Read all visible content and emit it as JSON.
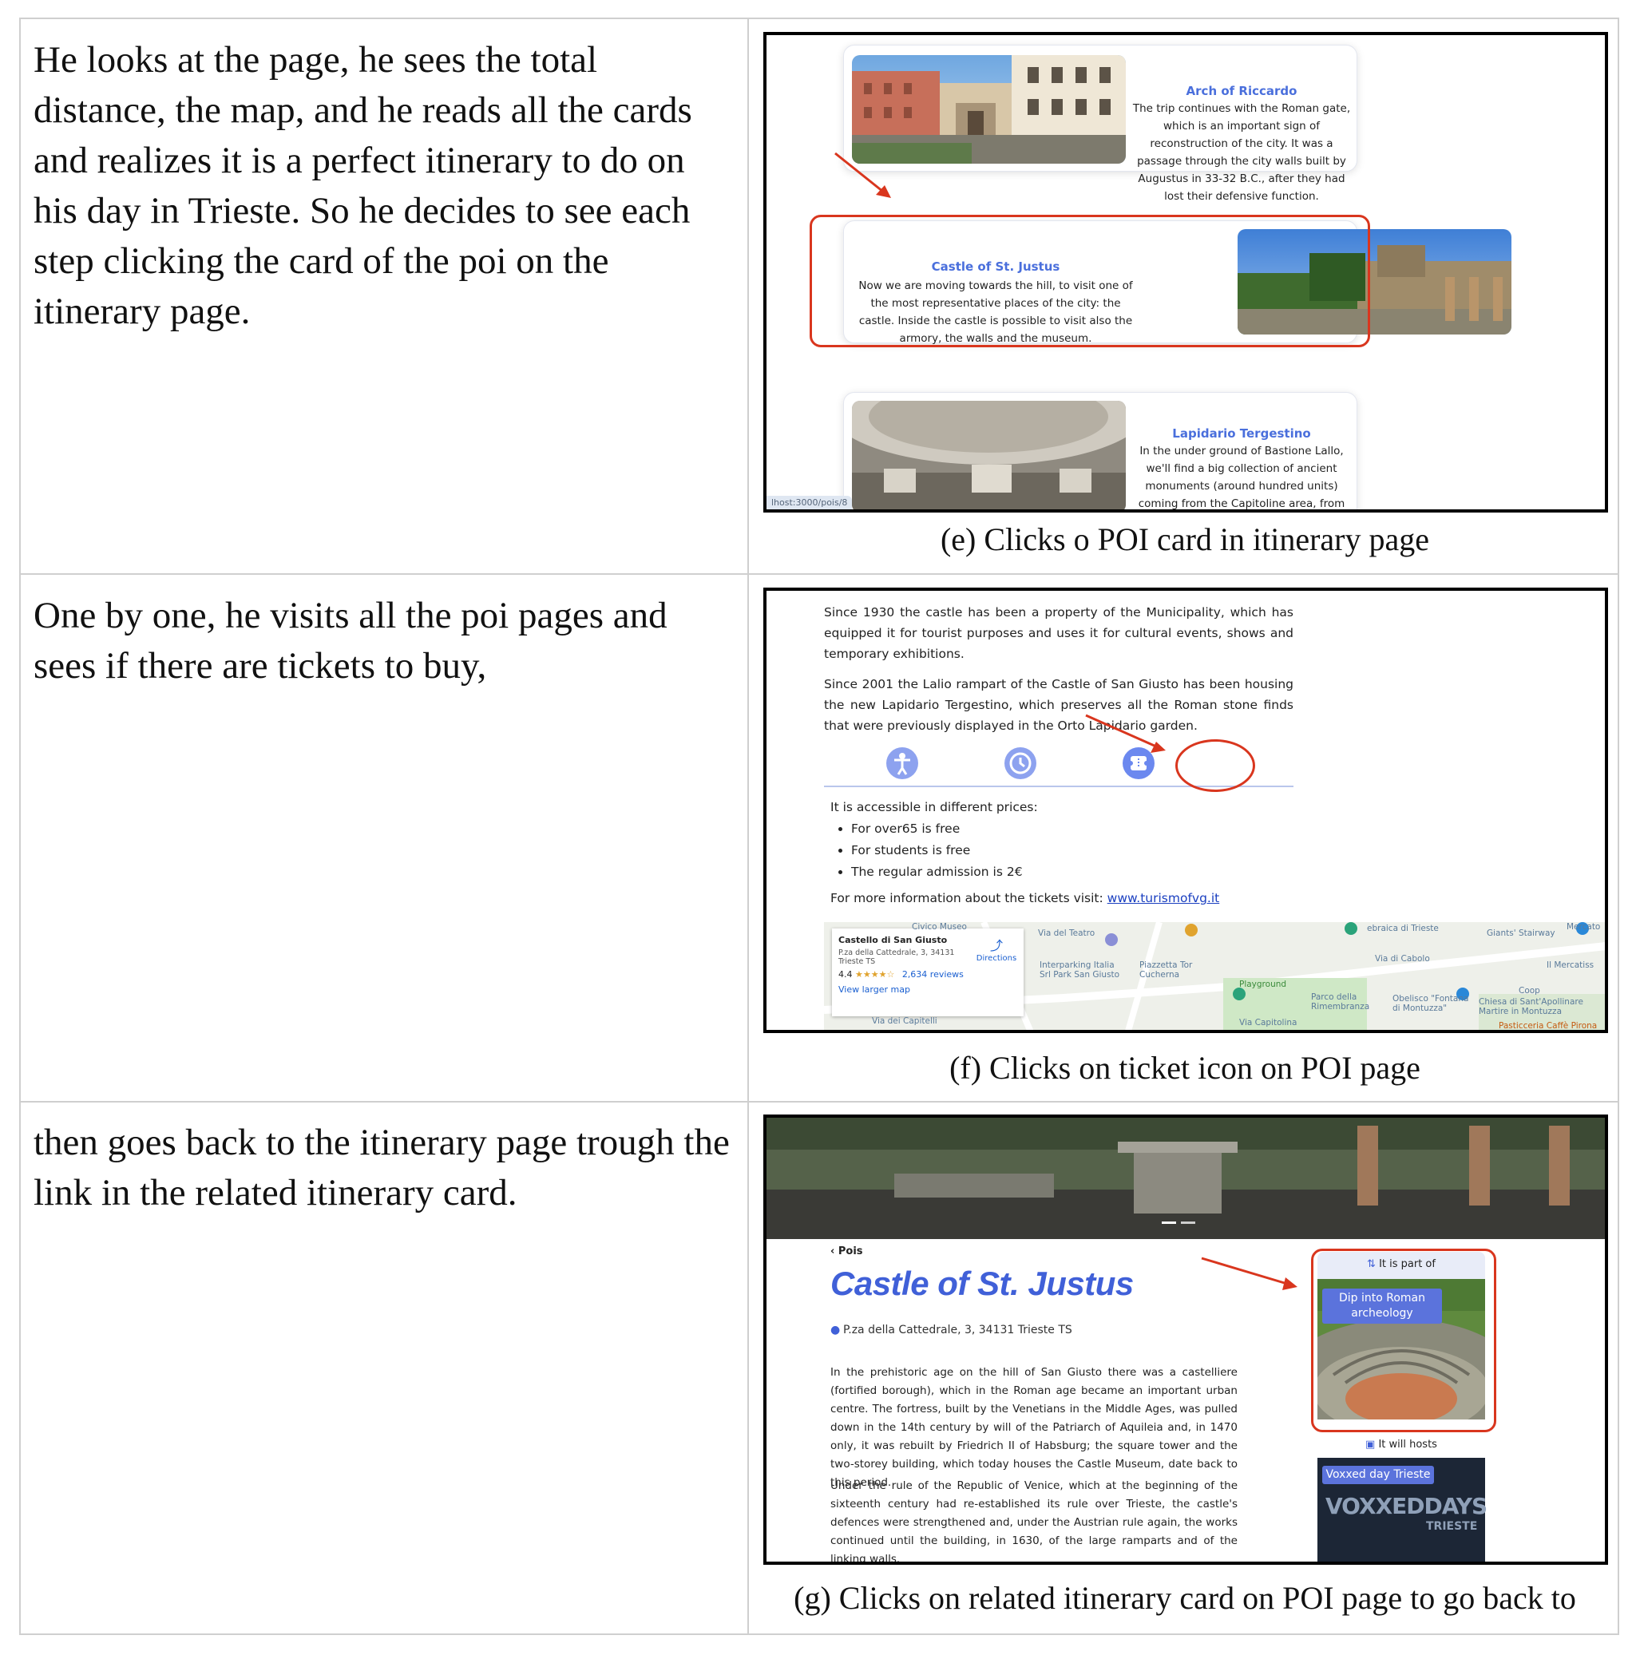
{
  "rows": [
    {
      "story": "He looks at the page, he sees the total distance, the map, and he reads all the cards and realizes it is a perfect itinerary to do on his day in Trieste. So he decides to see each step clicking the card of the poi on the itinerary page.",
      "caption": "(e) Clicks o POI card in itinerary page"
    },
    {
      "story": "One by one, he visits all the poi pages and sees if there are tickets to buy,",
      "caption": "(f) Clicks on ticket icon on POI page"
    },
    {
      "story": "then goes back to the itinerary page trough the link in the related itinerary card.",
      "caption": "(g) Clicks on related itinerary card on POI page to go back to"
    }
  ],
  "panel_e": {
    "cards": [
      {
        "title": "Arch of Riccardo",
        "description": "The trip continues with the Roman gate, which is an important sign of reconstruction of the city. It was a passage through the city walls built by Augustus in 33-32 B.C., after they had lost their defensive function."
      },
      {
        "title": "Castle of St. Justus",
        "description": "Now we are moving towards the hill, to visit one of the most representative places of the city: the castle. Inside the castle is possible to visit also the armory, the walls and the museum."
      },
      {
        "title": "Lapidario Tergestino",
        "description": "In the under ground of Bastione Lallo, we'll find a big collection of ancient monuments (around hundred units) coming from the Capitoline area, from sacred buildings, from the Theater and from the necropolis."
      }
    ],
    "status_url": "lhost:3000/pois/8",
    "highlight_color": "#d9361e"
  },
  "panel_f": {
    "paragraphs": [
      "Since 1930 the castle has been a property of the Municipality, which has equipped it for tourist purposes and uses it for cultural events, shows and temporary exhibitions.",
      "Since 2001 the Lalio rampart of the Castle of San Giusto has been housing the new Lapidario Tergestino, which preserves all the Roman stone finds that were previously displayed in the Orto Lapidario garden."
    ],
    "tabs": [
      {
        "icon": "accessibility-icon"
      },
      {
        "icon": "clock-icon"
      },
      {
        "icon": "ticket-icon"
      }
    ],
    "prices_intro": "It is accessible in different prices:",
    "prices": [
      "For over65 is free",
      "For students is free",
      "The regular admission is 2€"
    ],
    "more_info_label": "For more information about the tickets visit:",
    "more_info_link": "www.turismofvg.it",
    "map": {
      "place_name": "Castello di San Giusto",
      "place_address": "P.za della Cattedrale, 3, 34131 Trieste TS",
      "rating": "4.4",
      "stars": "★★★★☆",
      "reviews": "2,634 reviews",
      "directions": "Directions",
      "larger_map": "View larger map",
      "labels": [
        "Civico Museo",
        "Via del Teatro",
        "Interparking Italia Srl Park San Giusto",
        "Piazzetta Tor Cucherna",
        "Playground",
        "Parco della Rimembranza",
        "Obelisco \"Fontana di Montuzza\"",
        "Chiesa di Sant'Apollinare Martire in Montuzza",
        "Giants' Stairway",
        "Via di Cabolo",
        "Il Mercatiss",
        "Coop",
        "ebraica di Trieste",
        "Pasticceria Caffè Pirona",
        "Via Capitolina",
        "Via dei Capitelli",
        "Mercato"
      ]
    }
  },
  "panel_g": {
    "breadcrumb": "Pois",
    "title": "Castle of St. Justus",
    "address": "P.za della Cattedrale, 3, 34131 Trieste TS",
    "paragraphs": [
      "In the prehistoric age on the hill of San Giusto there was a castelliere (fortified borough), which in the Roman age became an important urban centre. The fortress, built by the Venetians in the Middle Ages, was pulled down in the 14th century by will of the Patriarch of Aquileia and, in 1470 only, it was rebuilt by Friedrich II of Habsburg; the square tower and the two-storey building, which today houses the Castle Museum, date back to this period.",
      "Under the rule of the Republic of Venice, which at the beginning of the sixteenth century had re-established its rule over Trieste, the castle's defences were strengthened and, under the Austrian rule again, the works continued until the building, in 1630, of the large ramparts and of the linking walls."
    ],
    "part_of_label": "It is part of",
    "itinerary_name": "Dip into Roman archeology",
    "hosts_label": "It will hosts",
    "event_name": "Voxxed day Trieste",
    "event_logo_main": "VOXXEDDAYS",
    "event_logo_sub": "TRIESTE"
  }
}
